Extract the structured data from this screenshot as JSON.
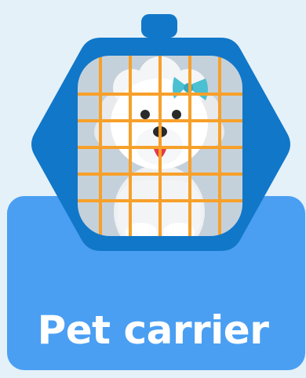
{
  "card": {
    "title": "Pet carrier",
    "icon": "pet-carrier-icon"
  },
  "colors": {
    "background": "#e4f1f9",
    "panel": "#4a9ff2",
    "carrier_frame": "#1177c9",
    "carrier_frame_light": "#2b8ad6",
    "bars": "#f7a02a",
    "window": "#c5d1da",
    "dog": "#ffffff",
    "bow": "#4bc0d2",
    "tongue": "#e33a47",
    "text": "#ffffff"
  }
}
